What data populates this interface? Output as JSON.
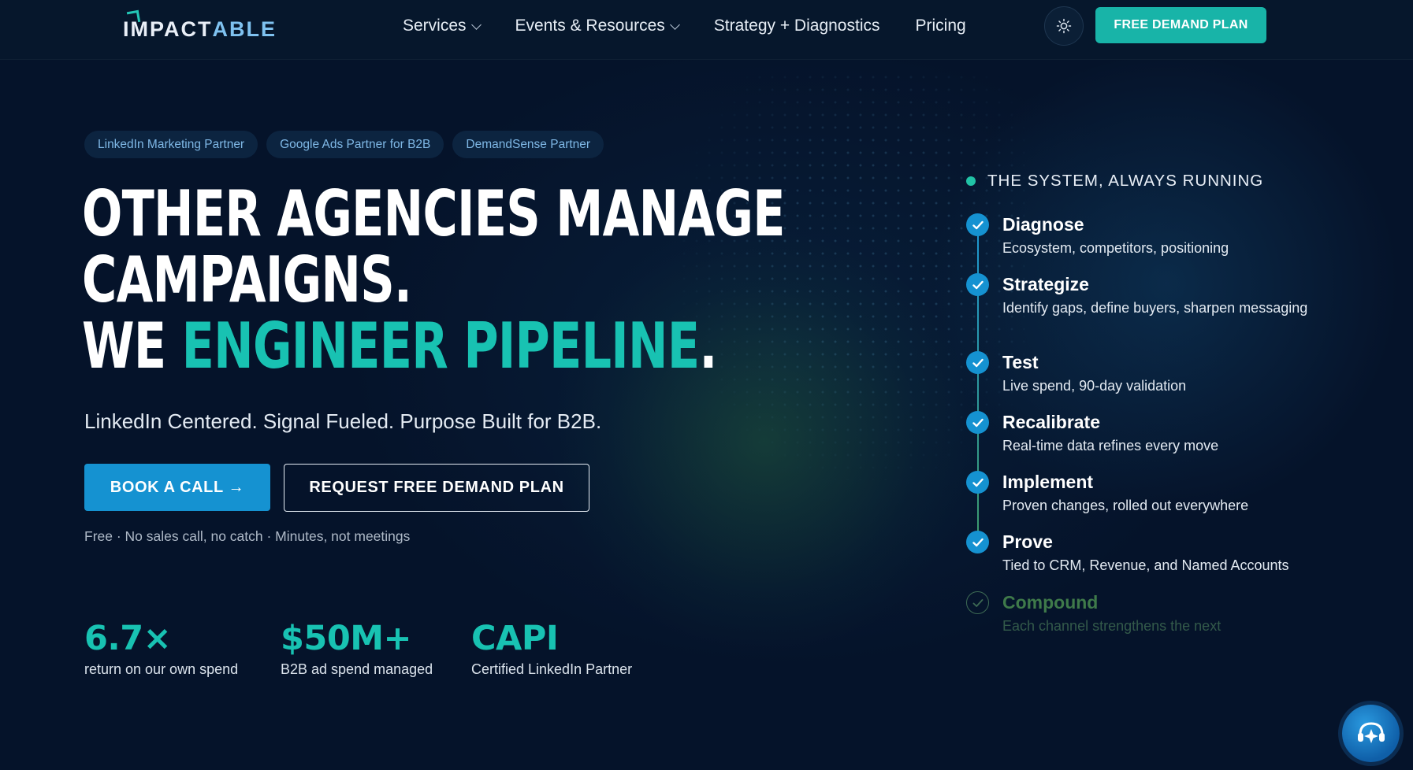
{
  "nav": {
    "logo_prefix": "IMPACT",
    "logo_suffix": "ABLE",
    "menu": [
      {
        "label": "Services",
        "has_dropdown": true
      },
      {
        "label": "Events & Resources",
        "has_dropdown": true
      },
      {
        "label": "Strategy + Diagnostics",
        "has_dropdown": false
      },
      {
        "label": "Pricing",
        "has_dropdown": false
      }
    ],
    "theme_icon": "sun-icon",
    "cta_label": "FREE DEMAND PLAN"
  },
  "hero": {
    "badges": [
      "LinkedIn Marketing Partner",
      "Google Ads Partner for B2B",
      "DemandSense Partner"
    ],
    "headline_line1": "OTHER AGENCIES MANAGE",
    "headline_line2": "CAMPAIGNS.",
    "headline_line3_prefix": "WE ",
    "headline_line3_accent": "ENGINEER PIPELINE",
    "headline_line3_suffix": ".",
    "subline": "LinkedIn Centered. Signal Fueled. Purpose Built for B2B.",
    "primary_button": "BOOK A CALL →",
    "secondary_button": "REQUEST FREE DEMAND PLAN",
    "fine_print": "Free · No sales call, no catch · Minutes, not meetings"
  },
  "stats": [
    {
      "value": "6.7×",
      "label": "return on our own spend"
    },
    {
      "value": "$50M+",
      "label": "B2B ad spend managed"
    },
    {
      "value": "CAPI",
      "label": "Certified LinkedIn Partner"
    }
  ],
  "system": {
    "title": "THE SYSTEM, ALWAYS RUNNING",
    "steps": [
      {
        "title": "Diagnose",
        "desc": "Ecosystem, competitors, positioning",
        "done": true
      },
      {
        "title": "Strategize",
        "desc": "Identify gaps, define buyers, sharpen messaging",
        "done": true
      },
      {
        "title": "Test",
        "desc": "Live spend, 90-day validation",
        "done": true
      },
      {
        "title": "Recalibrate",
        "desc": "Real-time data refines every move",
        "done": true
      },
      {
        "title": "Implement",
        "desc": "Proven changes, rolled out everywhere",
        "done": true
      },
      {
        "title": "Prove",
        "desc": "Tied to CRM, Revenue, and Named Accounts",
        "done": true
      },
      {
        "title": "Compound",
        "desc": "Each channel strengthens the next",
        "done": false
      }
    ]
  },
  "colors": {
    "background": "#05132a",
    "accent_teal": "#18c2b2",
    "accent_blue": "#1592d1"
  },
  "support_icon": "support-chat-icon"
}
